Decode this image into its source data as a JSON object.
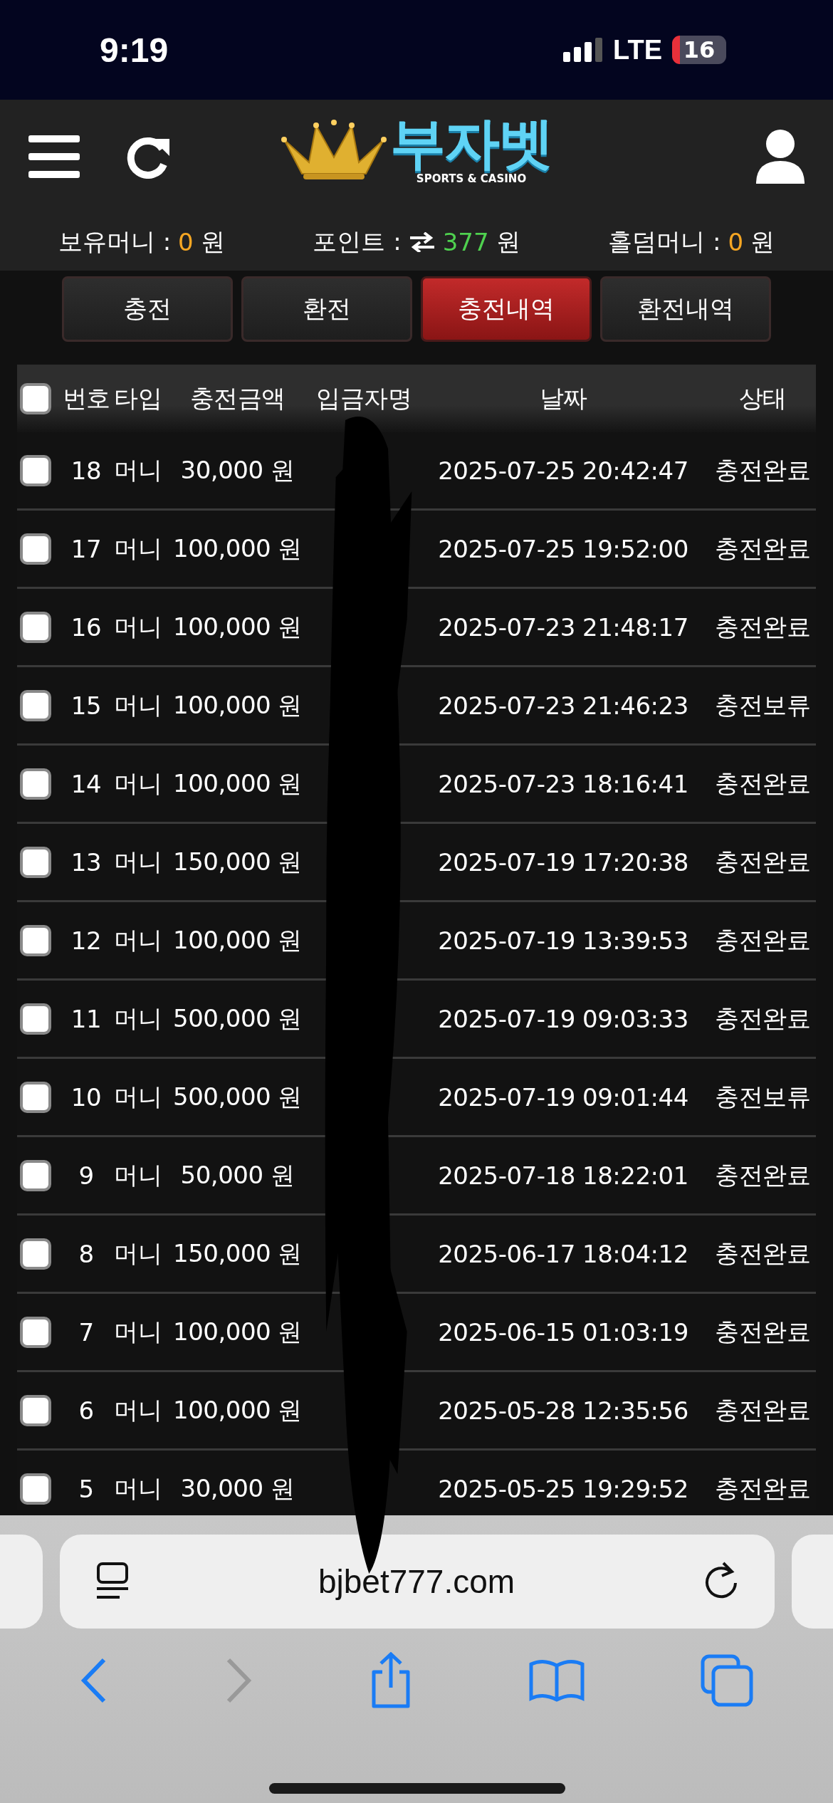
{
  "status_bar": {
    "time": "9:19",
    "network": "LTE",
    "battery": "16"
  },
  "header": {
    "logo_title": "부자벳",
    "logo_subtitle": "SPORTS & CASINO"
  },
  "balances": [
    {
      "label": "보유머니 :",
      "value": "0",
      "unit": "원",
      "kind": "plain"
    },
    {
      "label": "포인트 :",
      "value": "377",
      "unit": "원",
      "kind": "point"
    },
    {
      "label": "홀덤머니 :",
      "value": "0",
      "unit": "원",
      "kind": "plain"
    }
  ],
  "tabs": [
    {
      "label": "충전",
      "selected": false
    },
    {
      "label": "환전",
      "selected": false
    },
    {
      "label": "충전내역",
      "selected": true
    },
    {
      "label": "환전내역",
      "selected": false
    }
  ],
  "table": {
    "select_all": {
      "checked": false
    },
    "columns": [
      "번호",
      "타입",
      "충전금액",
      "입금자명",
      "날짜",
      "상태"
    ],
    "rows": [
      {
        "checked": false,
        "number": "18",
        "type": "머니",
        "amount": "30,000 원",
        "date": "2025-07-25 20:42:47",
        "status": "충전완료"
      },
      {
        "checked": false,
        "number": "17",
        "type": "머니",
        "amount": "100,000 원",
        "date": "2025-07-25 19:52:00",
        "status": "충전완료"
      },
      {
        "checked": false,
        "number": "16",
        "type": "머니",
        "amount": "100,000 원",
        "date": "2025-07-23 21:48:17",
        "status": "충전완료"
      },
      {
        "checked": false,
        "number": "15",
        "type": "머니",
        "amount": "100,000 원",
        "date": "2025-07-23 21:46:23",
        "status": "충전보류"
      },
      {
        "checked": false,
        "number": "14",
        "type": "머니",
        "amount": "100,000 원",
        "date": "2025-07-23 18:16:41",
        "status": "충전완료"
      },
      {
        "checked": false,
        "number": "13",
        "type": "머니",
        "amount": "150,000 원",
        "date": "2025-07-19 17:20:38",
        "status": "충전완료"
      },
      {
        "checked": false,
        "number": "12",
        "type": "머니",
        "amount": "100,000 원",
        "date": "2025-07-19 13:39:53",
        "status": "충전완료"
      },
      {
        "checked": false,
        "number": "11",
        "type": "머니",
        "amount": "500,000 원",
        "date": "2025-07-19 09:03:33",
        "status": "충전완료"
      },
      {
        "checked": false,
        "number": "10",
        "type": "머니",
        "amount": "500,000 원",
        "date": "2025-07-19 09:01:44",
        "status": "충전보류"
      },
      {
        "checked": false,
        "number": "9",
        "type": "머니",
        "amount": "50,000 원",
        "date": "2025-07-18 18:22:01",
        "status": "충전완료"
      },
      {
        "checked": false,
        "number": "8",
        "type": "머니",
        "amount": "150,000 원",
        "date": "2025-06-17 18:04:12",
        "status": "충전완료"
      },
      {
        "checked": false,
        "number": "7",
        "type": "머니",
        "amount": "100,000 원",
        "date": "2025-06-15 01:03:19",
        "status": "충전완료"
      },
      {
        "checked": false,
        "number": "6",
        "type": "머니",
        "amount": "100,000 원",
        "date": "2025-05-28 12:35:56",
        "status": "충전완료"
      },
      {
        "checked": false,
        "number": "5",
        "type": "머니",
        "amount": "30,000 원",
        "date": "2025-05-25 19:29:52",
        "status": "충전완료"
      }
    ]
  },
  "browser": {
    "url": "bjbet777.com"
  }
}
